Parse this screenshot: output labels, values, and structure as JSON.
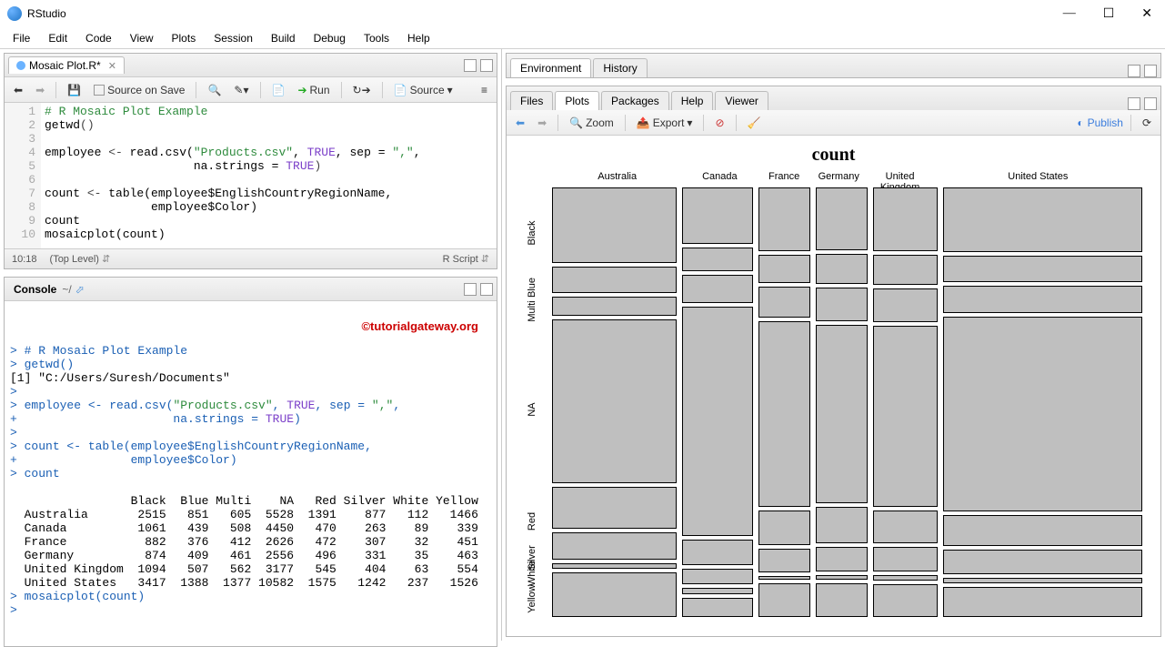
{
  "window": {
    "title": "RStudio"
  },
  "menu": [
    "File",
    "Edit",
    "Code",
    "View",
    "Plots",
    "Session",
    "Build",
    "Debug",
    "Tools",
    "Help"
  ],
  "source": {
    "tab_name": "Mosaic Plot.R*",
    "source_on_save": "Source on Save",
    "run": "Run",
    "source": "Source",
    "status_pos": "10:18",
    "status_scope": "(Top Level)",
    "status_lang": "R Script",
    "lines": [
      {
        "n": "1",
        "comment": "# R Mosaic Plot Example"
      },
      {
        "n": "2",
        "fn": "getwd",
        "paren": "()"
      },
      {
        "n": "3",
        "blank": " "
      },
      {
        "n": "4",
        "ident": "employee ",
        "op": "<-",
        "post": " read.csv(",
        "str": "\"Products.csv\"",
        "rest": ", ",
        "const": "TRUE",
        "rest2": ", sep = ",
        "str2": "\",\"",
        "rest3": ","
      },
      {
        "n": "5",
        "indent": "                     na.strings = ",
        "const": "TRUE",
        "paren": ")"
      },
      {
        "n": "6",
        "blank": " "
      },
      {
        "n": "7",
        "ident": "count ",
        "op": "<-",
        "post": " table(employee$EnglishCountryRegionName,"
      },
      {
        "n": "8",
        "indent": "               employee$Color)"
      },
      {
        "n": "9",
        "ident": "count"
      },
      {
        "n": "10",
        "ident": "mosaicplot(count)"
      }
    ]
  },
  "console": {
    "title": "Console",
    "path": "~/",
    "watermark": "©tutorialgateway.org",
    "text": "> # R Mosaic Plot Example\n> getwd()\n[1] \"C:/Users/Suresh/Documents\"\n> \n> employee <- read.csv(\"Products.csv\", TRUE, sep = \",\",\n+                      na.strings = TRUE)\n> \n> count <- table(employee$EnglishCountryRegionName,\n+                employee$Color)\n> count\n                \n                 Black  Blue Multi    NA   Red Silver White Yellow\n  Australia       2515   851   605  5528  1391    877   112   1466\n  Canada          1061   439   508  4450   470    263    89    339\n  France           882   376   412  2626   472    307    32    451\n  Germany          874   409   461  2556   496    331    35    463\n  United Kingdom  1094   507   562  3177   545    404    63    554\n  United States   3417  1388  1377 10582  1575   1242   237   1526\n> mosaicplot(count)\n> "
  },
  "env_tabs": [
    "Environment",
    "History"
  ],
  "plot_tabs": [
    "Files",
    "Plots",
    "Packages",
    "Help",
    "Viewer"
  ],
  "plot_toolbar": {
    "zoom": "Zoom",
    "export": "Export",
    "publish": "Publish"
  },
  "chart_data": {
    "type": "mosaic",
    "title": "count",
    "x_categories": [
      "Australia",
      "Canada",
      "France",
      "Germany",
      "United Kingdom",
      "United States"
    ],
    "y_categories": [
      "Black",
      "Blue",
      "Multi",
      "NA",
      "Red",
      "Silver",
      "White",
      "Yellow"
    ],
    "counts": {
      "Australia": {
        "Black": 2515,
        "Blue": 851,
        "Multi": 605,
        "NA": 5528,
        "Red": 1391,
        "Silver": 877,
        "White": 112,
        "Yellow": 1466
      },
      "Canada": {
        "Black": 1061,
        "Blue": 439,
        "Multi": 508,
        "NA": 4450,
        "Red": 470,
        "Silver": 263,
        "White": 89,
        "Yellow": 339
      },
      "France": {
        "Black": 882,
        "Blue": 376,
        "Multi": 412,
        "NA": 2626,
        "Red": 472,
        "Silver": 307,
        "White": 32,
        "Yellow": 451
      },
      "Germany": {
        "Black": 874,
        "Blue": 409,
        "Multi": 461,
        "NA": 2556,
        "Red": 496,
        "Silver": 331,
        "White": 35,
        "Yellow": 463
      },
      "United Kingdom": {
        "Black": 1094,
        "Blue": 507,
        "Multi": 562,
        "NA": 3177,
        "Red": 545,
        "Silver": 404,
        "White": 63,
        "Yellow": 554
      },
      "United States": {
        "Black": 3417,
        "Blue": 1388,
        "Multi": 1377,
        "NA": 10582,
        "Red": 1575,
        "Silver": 1242,
        "White": 237,
        "Yellow": 1526
      }
    }
  }
}
